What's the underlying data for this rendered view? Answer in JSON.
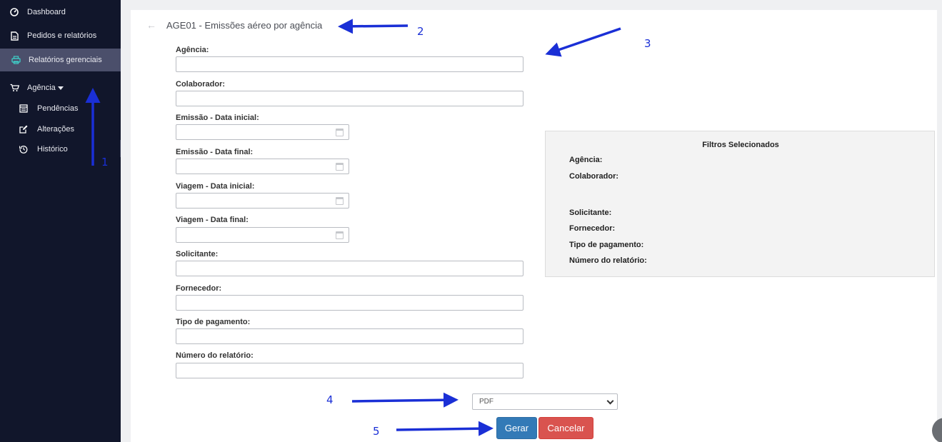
{
  "sidebar": {
    "items": [
      {
        "label": "Dashboard",
        "icon": "dashboard-icon"
      },
      {
        "label": "Pedidos e relatórios",
        "icon": "document-icon"
      },
      {
        "label": "Relatórios gerenciais",
        "icon": "printer-icon",
        "active": true
      },
      {
        "label": "Agência",
        "icon": "cart-icon",
        "expandable": true
      }
    ],
    "subitems": [
      {
        "label": "Pendências",
        "icon": "calendar-list-icon"
      },
      {
        "label": "Alterações",
        "icon": "edit-icon"
      },
      {
        "label": "Histórico",
        "icon": "history-icon"
      }
    ]
  },
  "header": {
    "title": "AGE01 - Emissões aéreo por agência"
  },
  "form": {
    "fields": [
      {
        "label": "Agência:",
        "type": "text",
        "value": ""
      },
      {
        "label": "Colaborador:",
        "type": "text",
        "value": ""
      },
      {
        "label": "Emissão - Data inicial:",
        "type": "date",
        "value": ""
      },
      {
        "label": "Emissão - Data final:",
        "type": "date",
        "value": ""
      },
      {
        "label": "Viagem - Data inicial:",
        "type": "date",
        "value": ""
      },
      {
        "label": "Viagem - Data final:",
        "type": "date",
        "value": ""
      },
      {
        "label": "Solicitante:",
        "type": "text",
        "value": ""
      },
      {
        "label": "Fornecedor:",
        "type": "text",
        "value": ""
      },
      {
        "label": "Tipo de pagamento:",
        "type": "text",
        "value": ""
      },
      {
        "label": "Número do relatório:",
        "type": "text",
        "value": ""
      }
    ],
    "format": {
      "selected": "PDF"
    },
    "submit_label": "Gerar",
    "cancel_label": "Cancelar"
  },
  "filters": {
    "title": "Filtros Selecionados",
    "items": [
      "Agência:",
      "Colaborador:",
      "Solicitante:",
      "Fornecedor:",
      "Tipo de pagamento:",
      "Número do relatório:"
    ]
  },
  "annotations": {
    "color": "#1a2fd6",
    "labels": [
      "1",
      "2",
      "3",
      "4",
      "5"
    ]
  },
  "colors": {
    "sidebar_bg": "#11162b",
    "sidebar_active": "#4b4f6b",
    "primary": "#337ab7",
    "danger": "#d9534f"
  }
}
